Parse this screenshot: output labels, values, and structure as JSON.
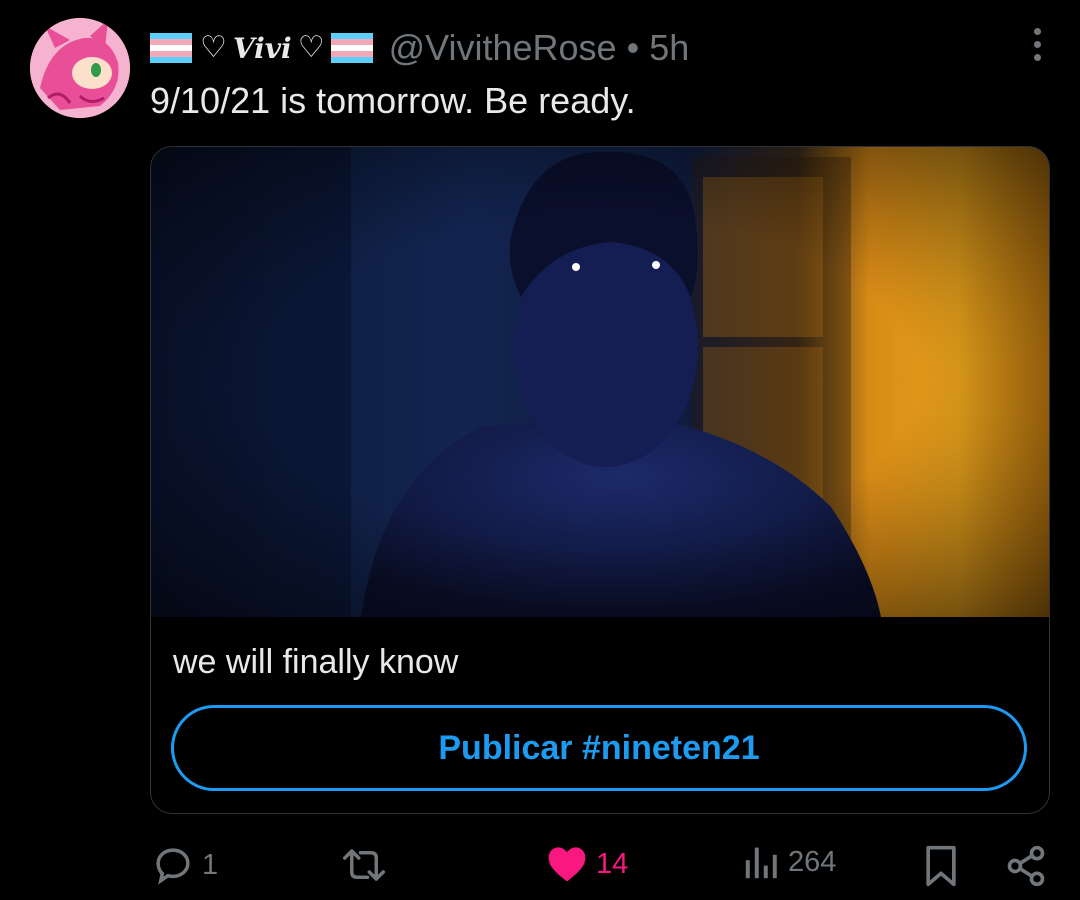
{
  "tweet": {
    "display_name": "Vivi",
    "handle": "@VivitheRose",
    "separator": "•",
    "time": "5h",
    "text": "9/10/21 is tomorrow. Be ready."
  },
  "card": {
    "caption": "we will finally know",
    "cta_label": "Publicar #nineten21"
  },
  "actions": {
    "replies": "1",
    "likes": "14",
    "views": "264"
  },
  "icons": [
    "more-icon",
    "reply-icon",
    "retweet-icon",
    "heart-icon",
    "views-icon",
    "bookmark-icon",
    "share-icon"
  ],
  "colors": {
    "background": "#000000",
    "text": "#e7e9ea",
    "muted": "#71767b",
    "accent": "#1d9bf0",
    "like": "#f91880"
  }
}
